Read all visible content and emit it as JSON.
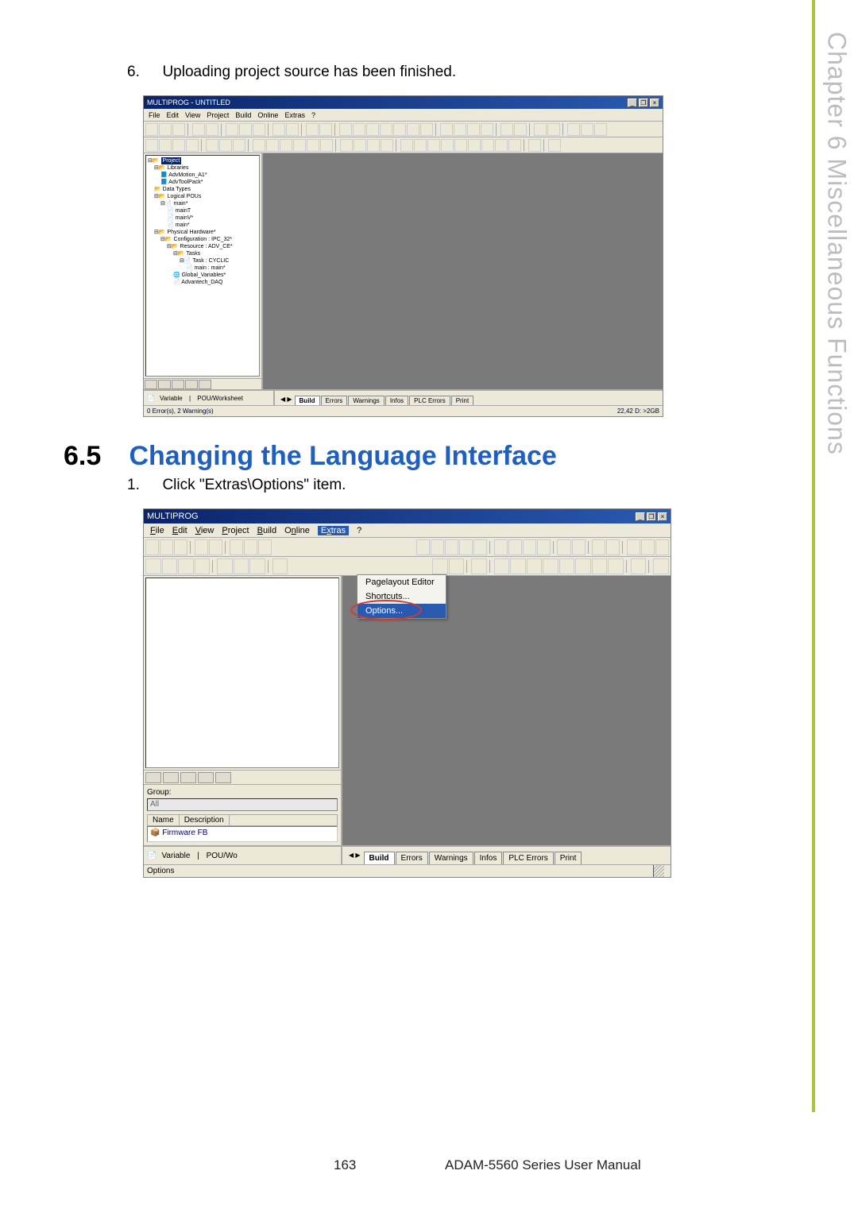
{
  "sideTab": "Chapter 6  Miscellaneous Functions",
  "step6": {
    "num": "6.",
    "text": "Uploading project source has been finished."
  },
  "screenshot1": {
    "title": "MULTIPROG - UNTITLED",
    "winbtns": {
      "min": "_",
      "max": "❐",
      "close": "×"
    },
    "menus": [
      "File",
      "Edit",
      "View",
      "Project",
      "Build",
      "Online",
      "Extras",
      "?"
    ],
    "tree": {
      "root": "Project",
      "nodes": [
        "Libraries",
        "AdvMotion_A1*",
        "AdvToolPack*",
        "Data Types",
        "Logical POUs",
        "main*",
        "mainT",
        "mainV*",
        "main*",
        "Physical Hardware*",
        "Configuration : IPC_32*",
        "Resource : ADV_CE*",
        "Tasks",
        "Task : CYCLIC",
        "main : main*",
        "Global_Variables*",
        "Advantech_DAQ"
      ]
    },
    "var": {
      "label": "Variable",
      "col2": "POU/Worksheet"
    },
    "msgTabs": [
      "Build",
      "Errors",
      "Warnings",
      "Infos",
      "PLC Errors",
      "Print"
    ],
    "status": {
      "left": "0 Error(s), 2 Warning(s)",
      "right": "22,42  D: >2GB"
    }
  },
  "section": {
    "num": "6.5",
    "title": "Changing the Language Interface"
  },
  "step1": {
    "num": "1.",
    "text": "Click \"Extras\\Options\" item."
  },
  "screenshot2": {
    "title": "MULTIPROG",
    "winbtns": {
      "min": "_",
      "max": "❐",
      "close": "×"
    },
    "menus": [
      "File",
      "Edit",
      "View",
      "Project",
      "Build",
      "Online",
      "Extras",
      "?"
    ],
    "dropdown": {
      "items": [
        "Pagelayout Editor",
        "Shortcuts...",
        "Options..."
      ],
      "selectedIndex": 2
    },
    "group": {
      "label": "Group:",
      "selected": "All"
    },
    "listHeader": {
      "c1": "Name",
      "c2": "Description"
    },
    "listRow": "Firmware FB",
    "var": {
      "label": "Variable",
      "col2": "POU/Wo"
    },
    "msgTabs": [
      "Build",
      "Errors",
      "Warnings",
      "Infos",
      "PLC Errors",
      "Print"
    ],
    "statusLeft": "Options"
  },
  "footer": {
    "page": "163",
    "manual": "ADAM-5560 Series User Manual"
  }
}
